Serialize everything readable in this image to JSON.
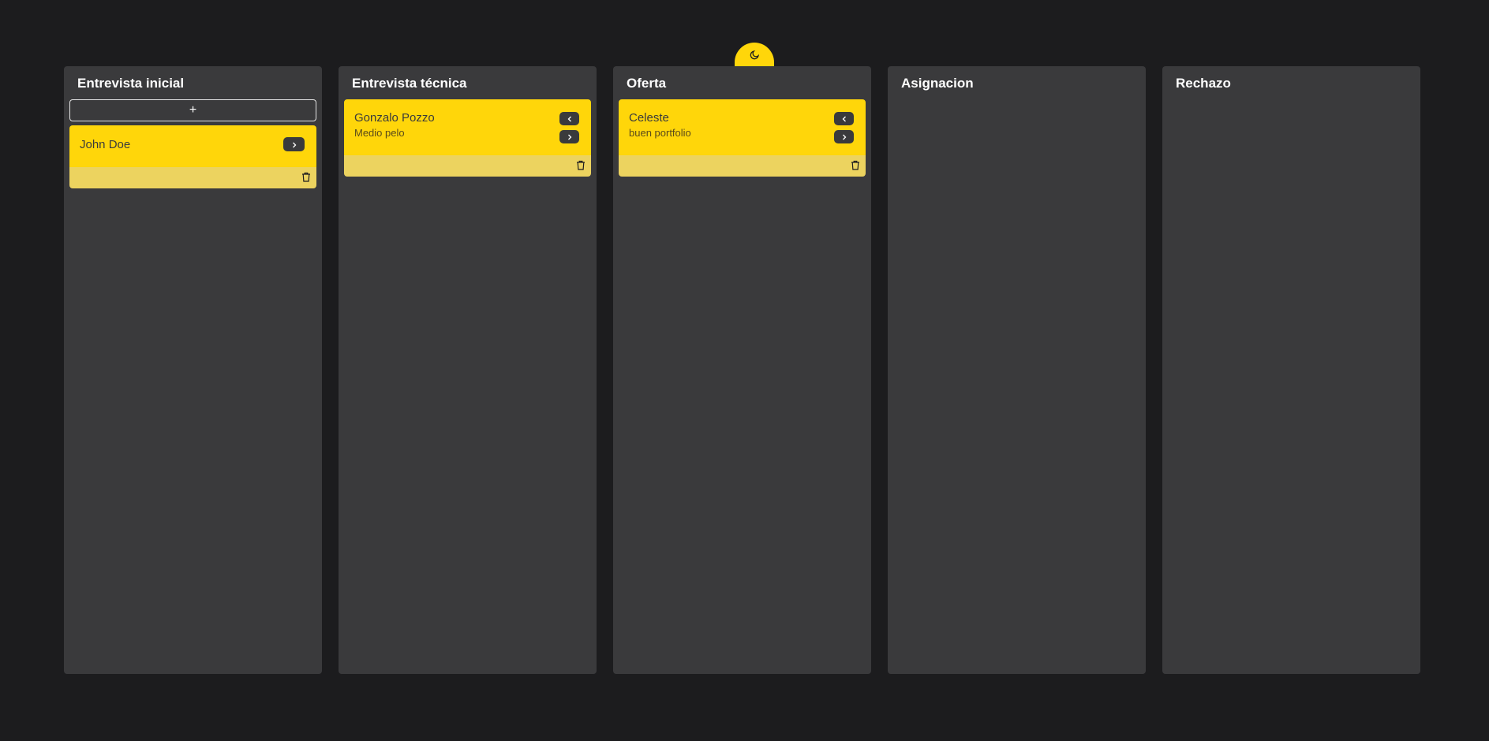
{
  "theme_toggle": {
    "icon": "moon-icon",
    "color": "#ffd60a"
  },
  "colors": {
    "background": "#1c1c1e",
    "column": "#3a3a3c",
    "card": "#ffd60a",
    "card_footer": "#ecd35f"
  },
  "columns": [
    {
      "title": "Entrevista inicial",
      "add_label": "+",
      "cards": [
        {
          "name": "John Doe",
          "note": ""
        }
      ]
    },
    {
      "title": "Entrevista técnica",
      "cards": [
        {
          "name": "Gonzalo Pozzo",
          "note": "Medio pelo"
        }
      ]
    },
    {
      "title": "Oferta",
      "cards": [
        {
          "name": "Celeste",
          "note": "buen portfolio"
        }
      ]
    },
    {
      "title": "Asignacion",
      "cards": []
    },
    {
      "title": "Rechazo",
      "cards": []
    }
  ]
}
